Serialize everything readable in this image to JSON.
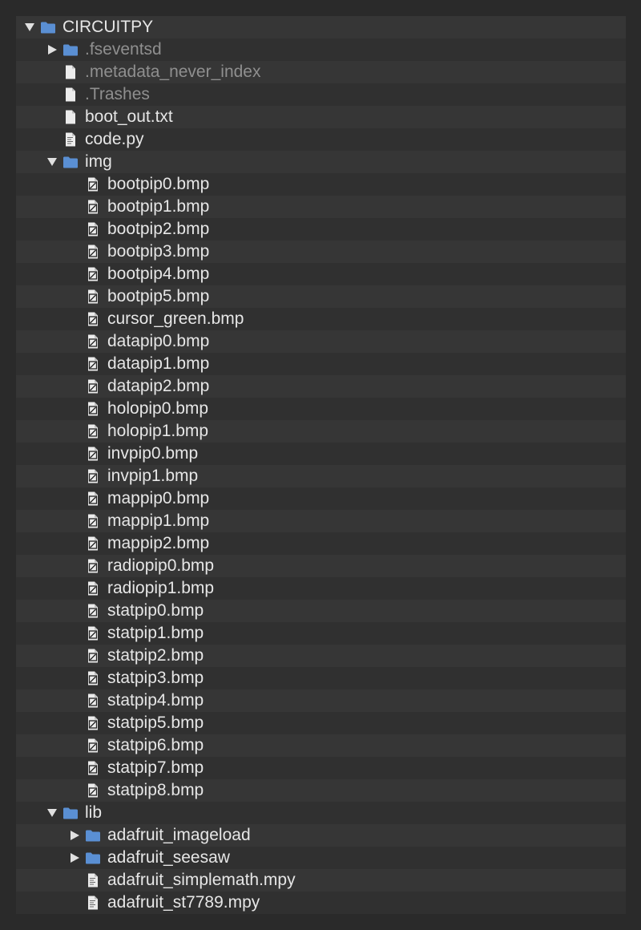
{
  "colors": {
    "background": "#2a2a2a",
    "row_odd": "#363636",
    "row_even": "#303030",
    "text": "#e6e6e6",
    "text_dim": "#8f8f8f",
    "folder": "#5a8fd3"
  },
  "tree": {
    "rows": [
      {
        "label": "CIRCUITPY",
        "depth": 0,
        "icon": "folder-icon",
        "toggle": "expanded",
        "dim": false
      },
      {
        "label": ".fseventsd",
        "depth": 1,
        "icon": "folder-icon",
        "toggle": "collapsed",
        "dim": true
      },
      {
        "label": ".metadata_never_index",
        "depth": 1,
        "icon": "file-icon",
        "toggle": "none",
        "dim": true
      },
      {
        "label": ".Trashes",
        "depth": 1,
        "icon": "file-icon",
        "toggle": "none",
        "dim": true
      },
      {
        "label": "boot_out.txt",
        "depth": 1,
        "icon": "file-icon",
        "toggle": "none",
        "dim": false
      },
      {
        "label": "code.py",
        "depth": 1,
        "icon": "python-file-icon",
        "toggle": "none",
        "dim": false
      },
      {
        "label": "img",
        "depth": 1,
        "icon": "folder-icon",
        "toggle": "expanded",
        "dim": false
      },
      {
        "label": "bootpip0.bmp",
        "depth": 2,
        "icon": "image-file-icon",
        "toggle": "none",
        "dim": false
      },
      {
        "label": "bootpip1.bmp",
        "depth": 2,
        "icon": "image-file-icon",
        "toggle": "none",
        "dim": false
      },
      {
        "label": "bootpip2.bmp",
        "depth": 2,
        "icon": "image-file-icon",
        "toggle": "none",
        "dim": false
      },
      {
        "label": "bootpip3.bmp",
        "depth": 2,
        "icon": "image-file-icon",
        "toggle": "none",
        "dim": false
      },
      {
        "label": "bootpip4.bmp",
        "depth": 2,
        "icon": "image-file-icon",
        "toggle": "none",
        "dim": false
      },
      {
        "label": "bootpip5.bmp",
        "depth": 2,
        "icon": "image-file-icon",
        "toggle": "none",
        "dim": false
      },
      {
        "label": "cursor_green.bmp",
        "depth": 2,
        "icon": "image-file-icon",
        "toggle": "none",
        "dim": false
      },
      {
        "label": "datapip0.bmp",
        "depth": 2,
        "icon": "image-file-icon",
        "toggle": "none",
        "dim": false
      },
      {
        "label": "datapip1.bmp",
        "depth": 2,
        "icon": "image-file-icon",
        "toggle": "none",
        "dim": false
      },
      {
        "label": "datapip2.bmp",
        "depth": 2,
        "icon": "image-file-icon",
        "toggle": "none",
        "dim": false
      },
      {
        "label": "holopip0.bmp",
        "depth": 2,
        "icon": "image-file-icon",
        "toggle": "none",
        "dim": false
      },
      {
        "label": "holopip1.bmp",
        "depth": 2,
        "icon": "image-file-icon",
        "toggle": "none",
        "dim": false
      },
      {
        "label": "invpip0.bmp",
        "depth": 2,
        "icon": "image-file-icon",
        "toggle": "none",
        "dim": false
      },
      {
        "label": "invpip1.bmp",
        "depth": 2,
        "icon": "image-file-icon",
        "toggle": "none",
        "dim": false
      },
      {
        "label": "mappip0.bmp",
        "depth": 2,
        "icon": "image-file-icon",
        "toggle": "none",
        "dim": false
      },
      {
        "label": "mappip1.bmp",
        "depth": 2,
        "icon": "image-file-icon",
        "toggle": "none",
        "dim": false
      },
      {
        "label": "mappip2.bmp",
        "depth": 2,
        "icon": "image-file-icon",
        "toggle": "none",
        "dim": false
      },
      {
        "label": "radiopip0.bmp",
        "depth": 2,
        "icon": "image-file-icon",
        "toggle": "none",
        "dim": false
      },
      {
        "label": "radiopip1.bmp",
        "depth": 2,
        "icon": "image-file-icon",
        "toggle": "none",
        "dim": false
      },
      {
        "label": "statpip0.bmp",
        "depth": 2,
        "icon": "image-file-icon",
        "toggle": "none",
        "dim": false
      },
      {
        "label": "statpip1.bmp",
        "depth": 2,
        "icon": "image-file-icon",
        "toggle": "none",
        "dim": false
      },
      {
        "label": "statpip2.bmp",
        "depth": 2,
        "icon": "image-file-icon",
        "toggle": "none",
        "dim": false
      },
      {
        "label": "statpip3.bmp",
        "depth": 2,
        "icon": "image-file-icon",
        "toggle": "none",
        "dim": false
      },
      {
        "label": "statpip4.bmp",
        "depth": 2,
        "icon": "image-file-icon",
        "toggle": "none",
        "dim": false
      },
      {
        "label": "statpip5.bmp",
        "depth": 2,
        "icon": "image-file-icon",
        "toggle": "none",
        "dim": false
      },
      {
        "label": "statpip6.bmp",
        "depth": 2,
        "icon": "image-file-icon",
        "toggle": "none",
        "dim": false
      },
      {
        "label": "statpip7.bmp",
        "depth": 2,
        "icon": "image-file-icon",
        "toggle": "none",
        "dim": false
      },
      {
        "label": "statpip8.bmp",
        "depth": 2,
        "icon": "image-file-icon",
        "toggle": "none",
        "dim": false
      },
      {
        "label": "lib",
        "depth": 1,
        "icon": "folder-icon",
        "toggle": "expanded",
        "dim": false
      },
      {
        "label": "adafruit_imageload",
        "depth": 2,
        "icon": "folder-icon",
        "toggle": "collapsed",
        "dim": false
      },
      {
        "label": "adafruit_seesaw",
        "depth": 2,
        "icon": "folder-icon",
        "toggle": "collapsed",
        "dim": false
      },
      {
        "label": "adafruit_simplemath.mpy",
        "depth": 2,
        "icon": "python-file-icon",
        "toggle": "none",
        "dim": false
      },
      {
        "label": "adafruit_st7789.mpy",
        "depth": 2,
        "icon": "python-file-icon",
        "toggle": "none",
        "dim": false
      }
    ]
  }
}
